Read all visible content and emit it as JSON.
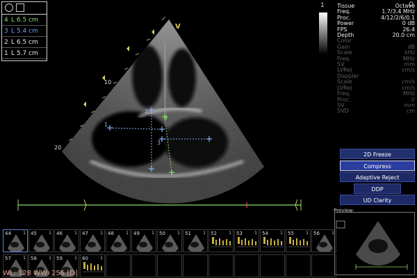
{
  "measurements": [
    {
      "num": "4",
      "text": "L 6.5 cm",
      "color": "#8fdc6c"
    },
    {
      "num": "3",
      "text": "L 5.4 cm",
      "color": "#6fa0ff"
    },
    {
      "num": "2",
      "text": "L 6.5 cm",
      "color": "#e8e8e8"
    },
    {
      "num": "1",
      "text": "L 5.7 cm",
      "color": "#e8e8e8"
    }
  ],
  "image_labels": {
    "depth_10": "10",
    "depth_20": "20",
    "orientation": "V",
    "marker_1": "1",
    "marker_2": "2",
    "marker_3": "3",
    "marker_4": "4"
  },
  "gray_top": "1",
  "corner_letter": "O",
  "params": [
    {
      "label": "Tissue",
      "value": "Octave",
      "kind": "bright"
    },
    {
      "label": "Freq.",
      "value": "1.7/3.4 MHz",
      "kind": "bright"
    },
    {
      "label": "Proc.",
      "value": "4/12/2/6/0.1",
      "kind": "bright"
    },
    {
      "label": "Power",
      "value": "0 dB",
      "kind": "bright"
    },
    {
      "label": "FPS",
      "value": "26.4",
      "kind": "bright"
    },
    {
      "label": "Depth",
      "value": "20.0 cm",
      "kind": "bright"
    },
    {
      "label": "Color",
      "value": "",
      "kind": "dim"
    },
    {
      "label": "Gain",
      "value": "dB",
      "kind": "dim"
    },
    {
      "label": "Scale",
      "value": "kHz",
      "kind": "dim"
    },
    {
      "label": "Freq.",
      "value": "MHz",
      "kind": "dim"
    },
    {
      "label": "SV",
      "value": "mm",
      "kind": "dim"
    },
    {
      "label": "LVRej",
      "value": "cm/s",
      "kind": "dim"
    },
    {
      "label": "Doppler",
      "value": "",
      "kind": "dim"
    },
    {
      "label": "Scale",
      "value": "cm/s",
      "kind": "dim"
    },
    {
      "label": "LVRej",
      "value": "cm/s",
      "kind": "dim"
    },
    {
      "label": "Freq.",
      "value": "MHz",
      "kind": "dim"
    },
    {
      "label": "Proc.",
      "value": "//",
      "kind": "dim"
    },
    {
      "label": "SV",
      "value": "mm",
      "kind": "dim"
    },
    {
      "label": "SVD",
      "value": "cm",
      "kind": "dim"
    }
  ],
  "menu": {
    "title": "2D Freeze",
    "items": [
      "Compress",
      "Adaptive Reject",
      "DDP",
      "UD Clarity"
    ]
  },
  "preview_label": "Preview:",
  "thumbnails": [
    {
      "num": "44",
      "one": "1",
      "selected": true,
      "kind": "heart"
    },
    {
      "num": "45",
      "one": "1",
      "kind": "heart"
    },
    {
      "num": "46",
      "one": "1",
      "kind": "heart"
    },
    {
      "num": "47",
      "one": "1",
      "kind": "heart"
    },
    {
      "num": "48",
      "one": "1",
      "kind": "heart"
    },
    {
      "num": "49",
      "one": "1",
      "kind": "heart"
    },
    {
      "num": "50",
      "one": "1",
      "kind": "heart"
    },
    {
      "num": "51",
      "one": "1",
      "kind": "heart"
    },
    {
      "num": "52",
      "one": "1",
      "kind": "doppler"
    },
    {
      "num": "53",
      "one": "1",
      "kind": "doppler"
    },
    {
      "num": "54",
      "one": "1",
      "kind": "doppler"
    },
    {
      "num": "55",
      "one": "1",
      "kind": "doppler"
    },
    {
      "num": "56",
      "one": "1",
      "kind": "heart"
    },
    {
      "num": "57",
      "one": "1",
      "kind": "heart"
    },
    {
      "num": "58",
      "one": "1",
      "kind": "heart"
    },
    {
      "num": "59",
      "one": "1",
      "kind": "heart"
    },
    {
      "num": "60",
      "one": "1",
      "kind": "doppler"
    }
  ],
  "wl_text": "WL: 128 WW: 256 [D]"
}
